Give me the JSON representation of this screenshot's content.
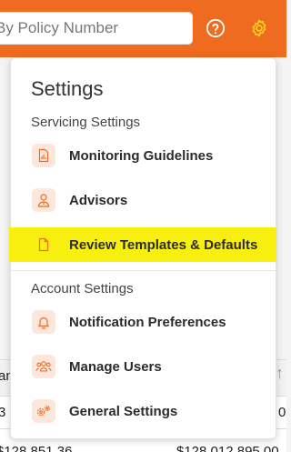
{
  "search": {
    "placeholder": "By Policy Number"
  },
  "header": {
    "help_icon": "help-circle-icon",
    "settings_icon": "gear-icon"
  },
  "background": {
    "cell_a": "$128,851.36",
    "cell_b": "$128,012,895.00",
    "row_left_1": "an",
    "row_left_2": "3",
    "row_right_2": "0"
  },
  "settings_menu": {
    "title": "Settings",
    "servicing_section": "Servicing Settings",
    "account_section": "Account Settings",
    "items": [
      {
        "label": "Monitoring Guidelines",
        "icon": "report-file-icon"
      },
      {
        "label": "Advisors",
        "icon": "advisor-user-icon"
      },
      {
        "label": "Review Templates & Defaults",
        "icon": "document-icon",
        "highlighted": true
      },
      {
        "label": "Notification Preferences",
        "icon": "bell-icon"
      },
      {
        "label": "Manage Users",
        "icon": "users-group-icon"
      },
      {
        "label": "General Settings",
        "icon": "gears-icon"
      }
    ]
  },
  "colors": {
    "brand_orange": "#ef6b1f",
    "highlight_yellow": "#f7f00f",
    "icon_bg": "#fde7dc"
  }
}
